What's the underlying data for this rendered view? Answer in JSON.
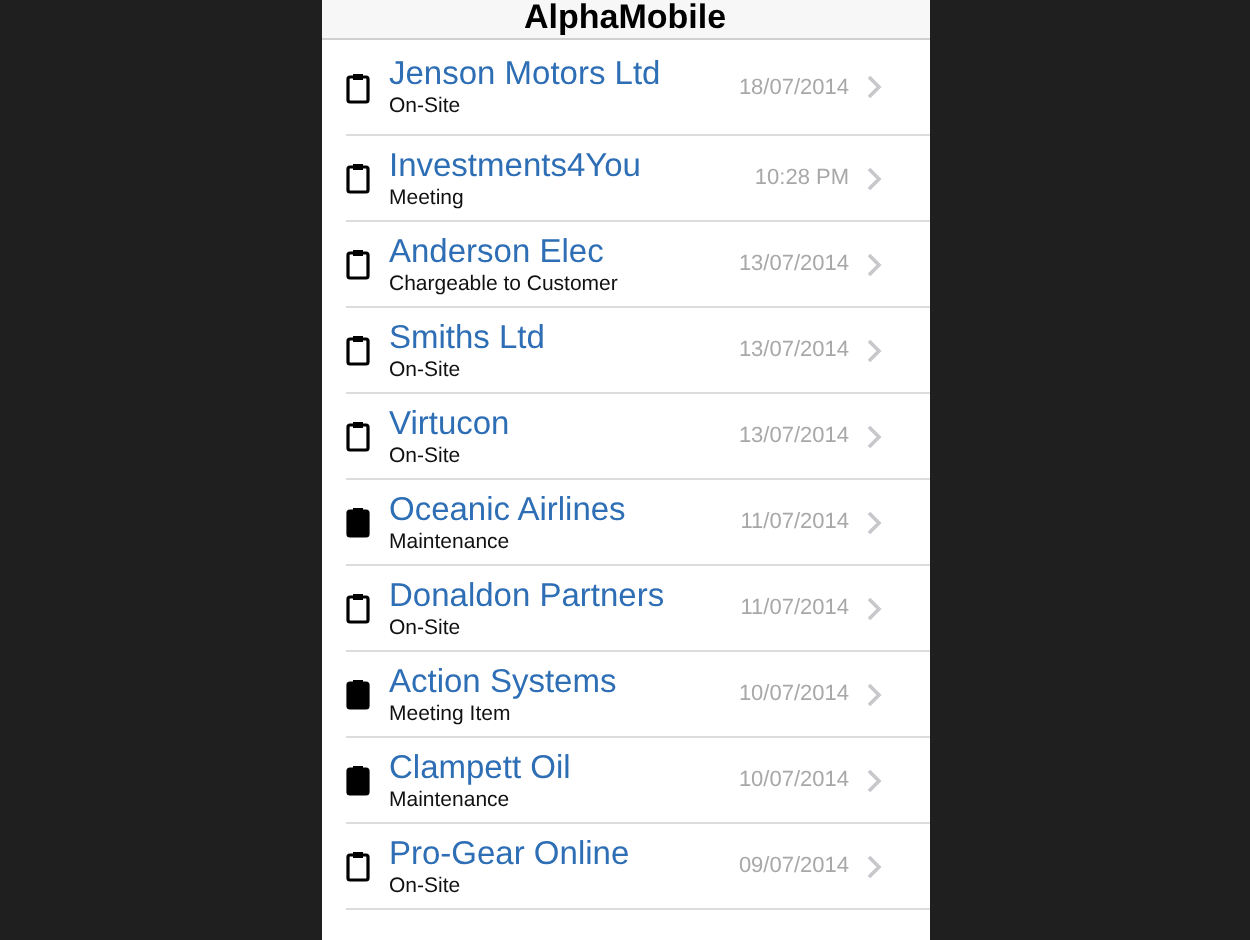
{
  "header": {
    "title": "AlphaMobile"
  },
  "items": [
    {
      "name": "Jenson Motors Ltd",
      "type": "On-Site",
      "date": "18/07/2014",
      "filled": false
    },
    {
      "name": "Investments4You",
      "type": "Meeting",
      "date": "10:28 PM",
      "filled": false
    },
    {
      "name": "Anderson Elec",
      "type": "Chargeable to Customer",
      "date": "13/07/2014",
      "filled": false
    },
    {
      "name": "Smiths Ltd",
      "type": "On-Site",
      "date": "13/07/2014",
      "filled": false
    },
    {
      "name": "Virtucon",
      "type": "On-Site",
      "date": "13/07/2014",
      "filled": false
    },
    {
      "name": "Oceanic Airlines",
      "type": "Maintenance",
      "date": "11/07/2014",
      "filled": true
    },
    {
      "name": "Donaldon Partners",
      "type": "On-Site",
      "date": "11/07/2014",
      "filled": false
    },
    {
      "name": "Action Systems",
      "type": "Meeting Item",
      "date": "10/07/2014",
      "filled": true
    },
    {
      "name": "Clampett Oil",
      "type": "Maintenance",
      "date": "10/07/2014",
      "filled": true
    },
    {
      "name": "Pro-Gear Online",
      "type": "On-Site",
      "date": "09/07/2014",
      "filled": false
    }
  ]
}
